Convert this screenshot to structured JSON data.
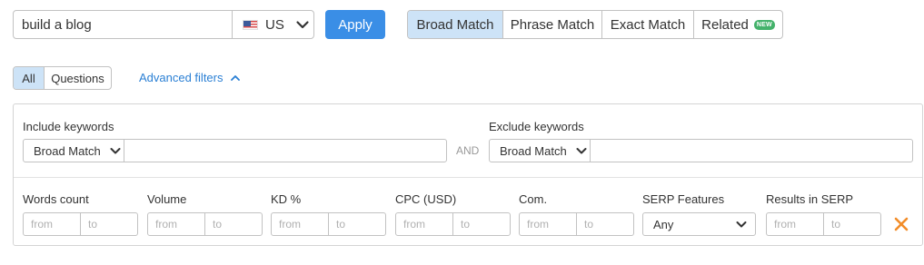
{
  "search": {
    "query": "build a blog",
    "country": "US",
    "country_flag": "us-flag-icon",
    "apply_label": "Apply"
  },
  "match_tabs": {
    "items": [
      {
        "label": "Broad Match",
        "active": true
      },
      {
        "label": "Phrase Match",
        "active": false
      },
      {
        "label": "Exact Match",
        "active": false
      },
      {
        "label": "Related",
        "active": false
      }
    ],
    "new_badge": "NEW"
  },
  "type_tabs": {
    "items": [
      {
        "label": "All",
        "active": true
      },
      {
        "label": "Questions",
        "active": false
      }
    ]
  },
  "advanced_filters": {
    "toggle_label": "Advanced filters",
    "expanded": true,
    "include": {
      "label": "Include keywords",
      "match_type": "Broad Match",
      "value": ""
    },
    "connector": "AND",
    "exclude": {
      "label": "Exclude keywords",
      "match_type": "Broad Match",
      "value": ""
    },
    "ranges": [
      {
        "label": "Words count",
        "from_placeholder": "from",
        "to_placeholder": "to"
      },
      {
        "label": "Volume",
        "from_placeholder": "from",
        "to_placeholder": "to"
      },
      {
        "label": "KD %",
        "from_placeholder": "from",
        "to_placeholder": "to"
      },
      {
        "label": "CPC (USD)",
        "from_placeholder": "from",
        "to_placeholder": "to"
      },
      {
        "label": "Com.",
        "from_placeholder": "from",
        "to_placeholder": "to"
      }
    ],
    "serp_features": {
      "label": "SERP Features",
      "value": "Any"
    },
    "results_in_serp": {
      "label": "Results in SERP",
      "from_placeholder": "from",
      "to_placeholder": "to"
    },
    "clear_icon": "close-icon"
  },
  "colors": {
    "accent": "#3a8ee6",
    "active_tab_bg": "#cde3f7",
    "link": "#2a7fd4",
    "badge_new": "#44b26b",
    "clear_icon": "#f28c28"
  }
}
